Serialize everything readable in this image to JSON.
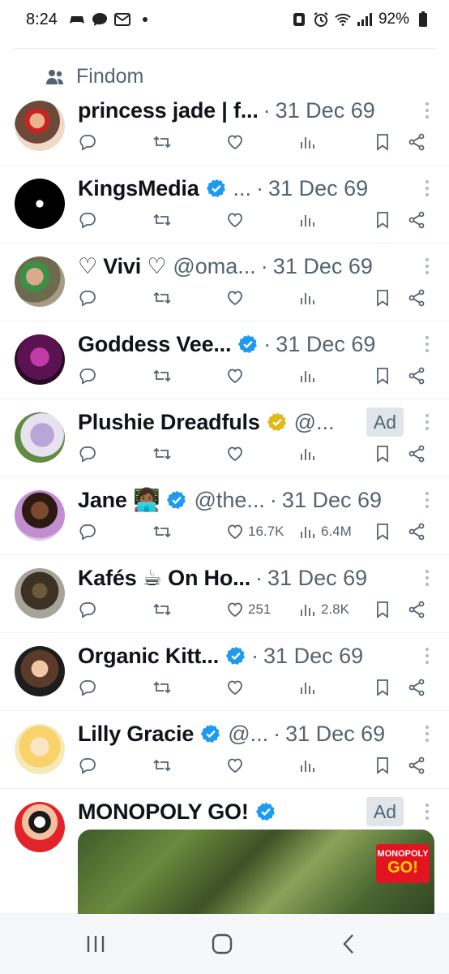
{
  "status_bar": {
    "time": "8:24",
    "battery": "92%"
  },
  "social_context": {
    "label": "Findom"
  },
  "colors": {
    "accent": "#1d9bf0",
    "gold_badge": "#e2b719",
    "secondary_text": "#536471"
  },
  "tweets": [
    {
      "name": "princess jade | f...",
      "handle": "",
      "dot": "·",
      "time": "31 Dec 69",
      "verified": "",
      "likes": "",
      "views": "",
      "ad": ""
    },
    {
      "name": "KingsMedia",
      "handle": "...",
      "dot": "·",
      "time": "31 Dec 69",
      "verified": "blue",
      "likes": "",
      "views": "",
      "ad": ""
    },
    {
      "name": "♡ Vivi ♡",
      "handle": "@oma...",
      "dot": "·",
      "time": "31 Dec 69",
      "verified": "",
      "likes": "",
      "views": "",
      "ad": ""
    },
    {
      "name": "Goddess Vee...",
      "handle": "",
      "dot": "·",
      "time": "31 Dec 69",
      "verified": "blue",
      "likes": "",
      "views": "",
      "ad": ""
    },
    {
      "name": "Plushie Dreadfuls",
      "handle": "@...",
      "dot": "",
      "time": "",
      "verified": "gold",
      "likes": "",
      "views": "",
      "ad": "Ad"
    },
    {
      "name": "Jane 👩🏾‍💻",
      "handle": "@the...",
      "dot": "·",
      "time": "31 Dec 69",
      "verified": "blue",
      "likes": "16.7K",
      "views": "6.4M",
      "ad": ""
    },
    {
      "name": "Kafés ☕ On Ho...",
      "handle": "",
      "dot": "·",
      "time": "31 Dec 69",
      "verified": "",
      "likes": "251",
      "views": "2.8K",
      "ad": ""
    },
    {
      "name": "Organic Kitt...",
      "handle": "",
      "dot": "·",
      "time": "31 Dec 69",
      "verified": "blue",
      "likes": "",
      "views": "",
      "ad": ""
    },
    {
      "name": "Lilly Gracie",
      "handle": "@...",
      "dot": "·",
      "time": "31 Dec 69",
      "verified": "blue",
      "likes": "",
      "views": "",
      "ad": ""
    },
    {
      "name": "MONOPOLY GO!",
      "handle": "",
      "dot": "",
      "time": "",
      "verified": "blue",
      "likes": "",
      "views": "",
      "ad": "Ad"
    }
  ],
  "media": {
    "logo_top": "MONOPOLY",
    "logo_bottom": "GO!"
  },
  "nav_bar": {
    "recents": "recents-icon",
    "home": "home-icon",
    "back": "back-icon"
  }
}
